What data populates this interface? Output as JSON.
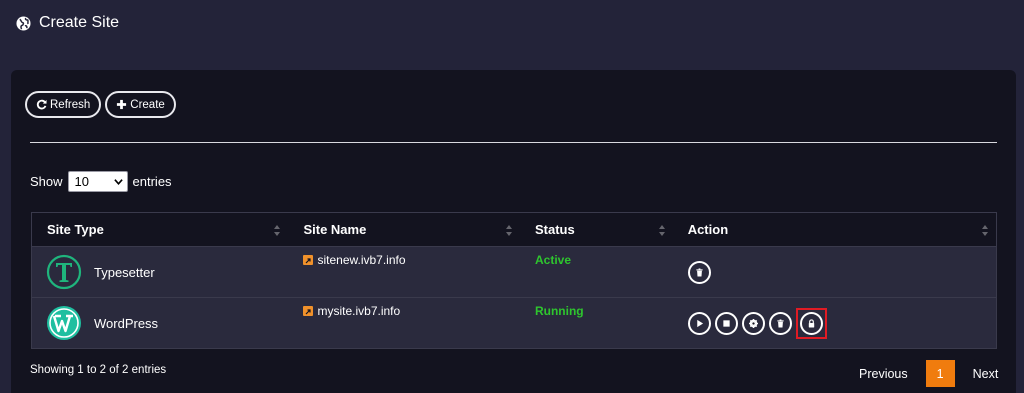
{
  "header": {
    "title": "Create Site",
    "icon": "globe-icon"
  },
  "toolbar": {
    "refresh_label": "Refresh",
    "create_label": "Create"
  },
  "length": {
    "show": "Show",
    "value": "10",
    "entries": "entries"
  },
  "table": {
    "columns": [
      "Site Type",
      "Site Name",
      "Status",
      "Action"
    ],
    "rows": [
      {
        "type": "Typesetter",
        "name": "sitenew.ivb7.info",
        "status": "Active",
        "actions": [
          "delete"
        ]
      },
      {
        "type": "WordPress",
        "name": "mysite.ivb7.info",
        "status": "Running",
        "actions": [
          "start",
          "stop",
          "settings",
          "delete",
          "lock"
        ]
      }
    ]
  },
  "footer": {
    "info": "Showing 1 to 2 of 2 entries",
    "previous": "Previous",
    "current_page": "1",
    "next": "Next"
  },
  "colors": {
    "background": "#232339",
    "panel": "#13131f",
    "row": "#2a2a3d",
    "status_green": "#2ec52e",
    "accent_orange": "#f07c0e",
    "highlight_red": "#e01b24",
    "typesetter_green": "#1fb57d",
    "wordpress_green": "#1fbfa0"
  }
}
